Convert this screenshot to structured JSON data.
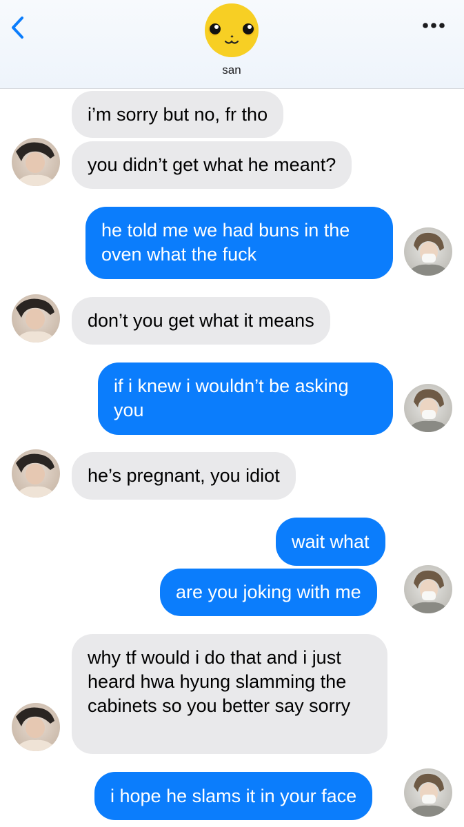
{
  "header": {
    "contact_name": "san",
    "back_icon": "chevron-left-icon",
    "more_icon": "ellipsis-icon",
    "accent": "#0b7dfc"
  },
  "colors": {
    "incoming_bubble": "#e9e9eb",
    "outgoing_bubble": "#0b7dfc"
  },
  "messages": [
    {
      "from": "san",
      "text": "i’m sorry but no, fr tho"
    },
    {
      "from": "san",
      "text": "you didn’t get what he meant?"
    },
    {
      "from": "me",
      "text": "he told me we had buns in the oven what the fuck"
    },
    {
      "from": "san",
      "text": "don’t you get what it means"
    },
    {
      "from": "me",
      "text": "if i knew i wouldn’t be asking you"
    },
    {
      "from": "san",
      "text": "he’s pregnant, you idiot"
    },
    {
      "from": "me",
      "text": "wait what"
    },
    {
      "from": "me",
      "text": "are you joking with me"
    },
    {
      "from": "san",
      "text": "why tf would i do that and i just heard hwa hyung slamming the cabinets so you better say sorry"
    },
    {
      "from": "me",
      "text": "i hope he slams it in your face"
    }
  ]
}
